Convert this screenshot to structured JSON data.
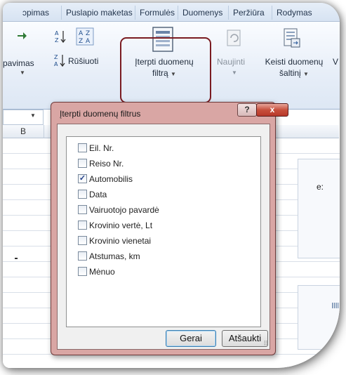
{
  "ribbon": {
    "tabs": [
      "ɔpimas",
      "Puslapio maketas",
      "Formulės",
      "Duomenys",
      "Peržiūra",
      "Rodymas"
    ],
    "group_filter_label": "pavimas",
    "sort_label": "Rūšiuoti",
    "insert_slicer_line1": "Įterpti duomenų",
    "insert_slicer_line2": "filtrą",
    "refresh_label": "Naujinti",
    "change_source_line1": "Keisti duomenų",
    "change_source_line2": "šaltinį",
    "cut_label": "V"
  },
  "sheet": {
    "column_b": "B",
    "cell_text": "e:"
  },
  "dialog": {
    "title": "Įterpti duomenų filtrus",
    "help_symbol": "?",
    "close_symbol": "x",
    "fields": [
      {
        "label": "Eil. Nr.",
        "checked": false
      },
      {
        "label": "Reiso Nr.",
        "checked": false
      },
      {
        "label": "Automobilis",
        "checked": true
      },
      {
        "label": "Data",
        "checked": false
      },
      {
        "label": "Vairuotojo pavardė",
        "checked": false
      },
      {
        "label": "Krovinio vertė, Lt",
        "checked": false
      },
      {
        "label": "Krovinio vienetai",
        "checked": false
      },
      {
        "label": "Atstumas, km",
        "checked": false
      },
      {
        "label": "Mėnuo",
        "checked": false
      }
    ],
    "ok_label": "Gerai",
    "cancel_label": "Atšaukti"
  }
}
